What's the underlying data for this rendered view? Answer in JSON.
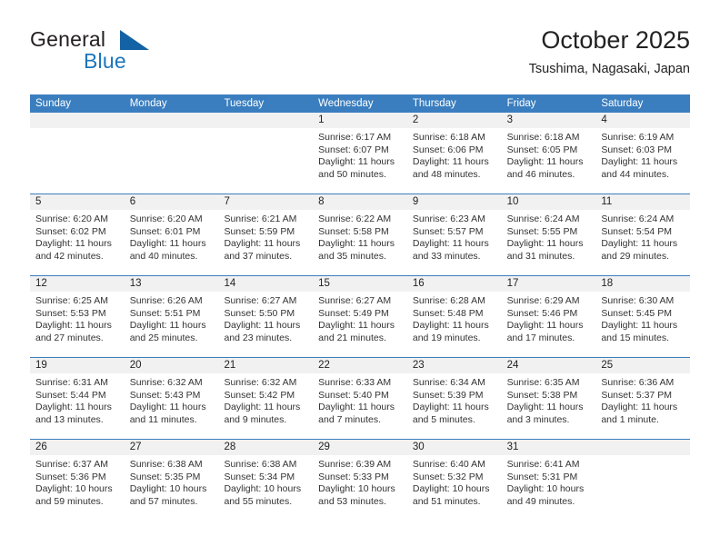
{
  "brand": {
    "name_part1": "General",
    "name_part2": "Blue",
    "logo_icon": "triangle-logo-icon"
  },
  "header": {
    "title": "October 2025",
    "subtitle": "Tsushima, Nagasaki, Japan"
  },
  "colors": {
    "header_blue": "#3a7ebf",
    "brand_blue": "#1b75bb",
    "date_band": "#f1f1f1",
    "text": "#222222"
  },
  "weekdays": [
    "Sunday",
    "Monday",
    "Tuesday",
    "Wednesday",
    "Thursday",
    "Friday",
    "Saturday"
  ],
  "labels": {
    "sunrise_prefix": "Sunrise:",
    "sunset_prefix": "Sunset:",
    "daylight_prefix": "Daylight:"
  },
  "weeks": [
    [
      {
        "date": "",
        "empty": true
      },
      {
        "date": "",
        "empty": true
      },
      {
        "date": "",
        "empty": true
      },
      {
        "date": "1",
        "sunrise": "Sunrise: 6:17 AM",
        "sunset": "Sunset: 6:07 PM",
        "daylight_line1": "Daylight: 11 hours",
        "daylight_line2": "and 50 minutes."
      },
      {
        "date": "2",
        "sunrise": "Sunrise: 6:18 AM",
        "sunset": "Sunset: 6:06 PM",
        "daylight_line1": "Daylight: 11 hours",
        "daylight_line2": "and 48 minutes."
      },
      {
        "date": "3",
        "sunrise": "Sunrise: 6:18 AM",
        "sunset": "Sunset: 6:05 PM",
        "daylight_line1": "Daylight: 11 hours",
        "daylight_line2": "and 46 minutes."
      },
      {
        "date": "4",
        "sunrise": "Sunrise: 6:19 AM",
        "sunset": "Sunset: 6:03 PM",
        "daylight_line1": "Daylight: 11 hours",
        "daylight_line2": "and 44 minutes."
      }
    ],
    [
      {
        "date": "5",
        "sunrise": "Sunrise: 6:20 AM",
        "sunset": "Sunset: 6:02 PM",
        "daylight_line1": "Daylight: 11 hours",
        "daylight_line2": "and 42 minutes."
      },
      {
        "date": "6",
        "sunrise": "Sunrise: 6:20 AM",
        "sunset": "Sunset: 6:01 PM",
        "daylight_line1": "Daylight: 11 hours",
        "daylight_line2": "and 40 minutes."
      },
      {
        "date": "7",
        "sunrise": "Sunrise: 6:21 AM",
        "sunset": "Sunset: 5:59 PM",
        "daylight_line1": "Daylight: 11 hours",
        "daylight_line2": "and 37 minutes."
      },
      {
        "date": "8",
        "sunrise": "Sunrise: 6:22 AM",
        "sunset": "Sunset: 5:58 PM",
        "daylight_line1": "Daylight: 11 hours",
        "daylight_line2": "and 35 minutes."
      },
      {
        "date": "9",
        "sunrise": "Sunrise: 6:23 AM",
        "sunset": "Sunset: 5:57 PM",
        "daylight_line1": "Daylight: 11 hours",
        "daylight_line2": "and 33 minutes."
      },
      {
        "date": "10",
        "sunrise": "Sunrise: 6:24 AM",
        "sunset": "Sunset: 5:55 PM",
        "daylight_line1": "Daylight: 11 hours",
        "daylight_line2": "and 31 minutes."
      },
      {
        "date": "11",
        "sunrise": "Sunrise: 6:24 AM",
        "sunset": "Sunset: 5:54 PM",
        "daylight_line1": "Daylight: 11 hours",
        "daylight_line2": "and 29 minutes."
      }
    ],
    [
      {
        "date": "12",
        "sunrise": "Sunrise: 6:25 AM",
        "sunset": "Sunset: 5:53 PM",
        "daylight_line1": "Daylight: 11 hours",
        "daylight_line2": "and 27 minutes."
      },
      {
        "date": "13",
        "sunrise": "Sunrise: 6:26 AM",
        "sunset": "Sunset: 5:51 PM",
        "daylight_line1": "Daylight: 11 hours",
        "daylight_line2": "and 25 minutes."
      },
      {
        "date": "14",
        "sunrise": "Sunrise: 6:27 AM",
        "sunset": "Sunset: 5:50 PM",
        "daylight_line1": "Daylight: 11 hours",
        "daylight_line2": "and 23 minutes."
      },
      {
        "date": "15",
        "sunrise": "Sunrise: 6:27 AM",
        "sunset": "Sunset: 5:49 PM",
        "daylight_line1": "Daylight: 11 hours",
        "daylight_line2": "and 21 minutes."
      },
      {
        "date": "16",
        "sunrise": "Sunrise: 6:28 AM",
        "sunset": "Sunset: 5:48 PM",
        "daylight_line1": "Daylight: 11 hours",
        "daylight_line2": "and 19 minutes."
      },
      {
        "date": "17",
        "sunrise": "Sunrise: 6:29 AM",
        "sunset": "Sunset: 5:46 PM",
        "daylight_line1": "Daylight: 11 hours",
        "daylight_line2": "and 17 minutes."
      },
      {
        "date": "18",
        "sunrise": "Sunrise: 6:30 AM",
        "sunset": "Sunset: 5:45 PM",
        "daylight_line1": "Daylight: 11 hours",
        "daylight_line2": "and 15 minutes."
      }
    ],
    [
      {
        "date": "19",
        "sunrise": "Sunrise: 6:31 AM",
        "sunset": "Sunset: 5:44 PM",
        "daylight_line1": "Daylight: 11 hours",
        "daylight_line2": "and 13 minutes."
      },
      {
        "date": "20",
        "sunrise": "Sunrise: 6:32 AM",
        "sunset": "Sunset: 5:43 PM",
        "daylight_line1": "Daylight: 11 hours",
        "daylight_line2": "and 11 minutes."
      },
      {
        "date": "21",
        "sunrise": "Sunrise: 6:32 AM",
        "sunset": "Sunset: 5:42 PM",
        "daylight_line1": "Daylight: 11 hours",
        "daylight_line2": "and 9 minutes."
      },
      {
        "date": "22",
        "sunrise": "Sunrise: 6:33 AM",
        "sunset": "Sunset: 5:40 PM",
        "daylight_line1": "Daylight: 11 hours",
        "daylight_line2": "and 7 minutes."
      },
      {
        "date": "23",
        "sunrise": "Sunrise: 6:34 AM",
        "sunset": "Sunset: 5:39 PM",
        "daylight_line1": "Daylight: 11 hours",
        "daylight_line2": "and 5 minutes."
      },
      {
        "date": "24",
        "sunrise": "Sunrise: 6:35 AM",
        "sunset": "Sunset: 5:38 PM",
        "daylight_line1": "Daylight: 11 hours",
        "daylight_line2": "and 3 minutes."
      },
      {
        "date": "25",
        "sunrise": "Sunrise: 6:36 AM",
        "sunset": "Sunset: 5:37 PM",
        "daylight_line1": "Daylight: 11 hours",
        "daylight_line2": "and 1 minute."
      }
    ],
    [
      {
        "date": "26",
        "sunrise": "Sunrise: 6:37 AM",
        "sunset": "Sunset: 5:36 PM",
        "daylight_line1": "Daylight: 10 hours",
        "daylight_line2": "and 59 minutes."
      },
      {
        "date": "27",
        "sunrise": "Sunrise: 6:38 AM",
        "sunset": "Sunset: 5:35 PM",
        "daylight_line1": "Daylight: 10 hours",
        "daylight_line2": "and 57 minutes."
      },
      {
        "date": "28",
        "sunrise": "Sunrise: 6:38 AM",
        "sunset": "Sunset: 5:34 PM",
        "daylight_line1": "Daylight: 10 hours",
        "daylight_line2": "and 55 minutes."
      },
      {
        "date": "29",
        "sunrise": "Sunrise: 6:39 AM",
        "sunset": "Sunset: 5:33 PM",
        "daylight_line1": "Daylight: 10 hours",
        "daylight_line2": "and 53 minutes."
      },
      {
        "date": "30",
        "sunrise": "Sunrise: 6:40 AM",
        "sunset": "Sunset: 5:32 PM",
        "daylight_line1": "Daylight: 10 hours",
        "daylight_line2": "and 51 minutes."
      },
      {
        "date": "31",
        "sunrise": "Sunrise: 6:41 AM",
        "sunset": "Sunset: 5:31 PM",
        "daylight_line1": "Daylight: 10 hours",
        "daylight_line2": "and 49 minutes."
      },
      {
        "date": "",
        "empty": true
      }
    ]
  ]
}
